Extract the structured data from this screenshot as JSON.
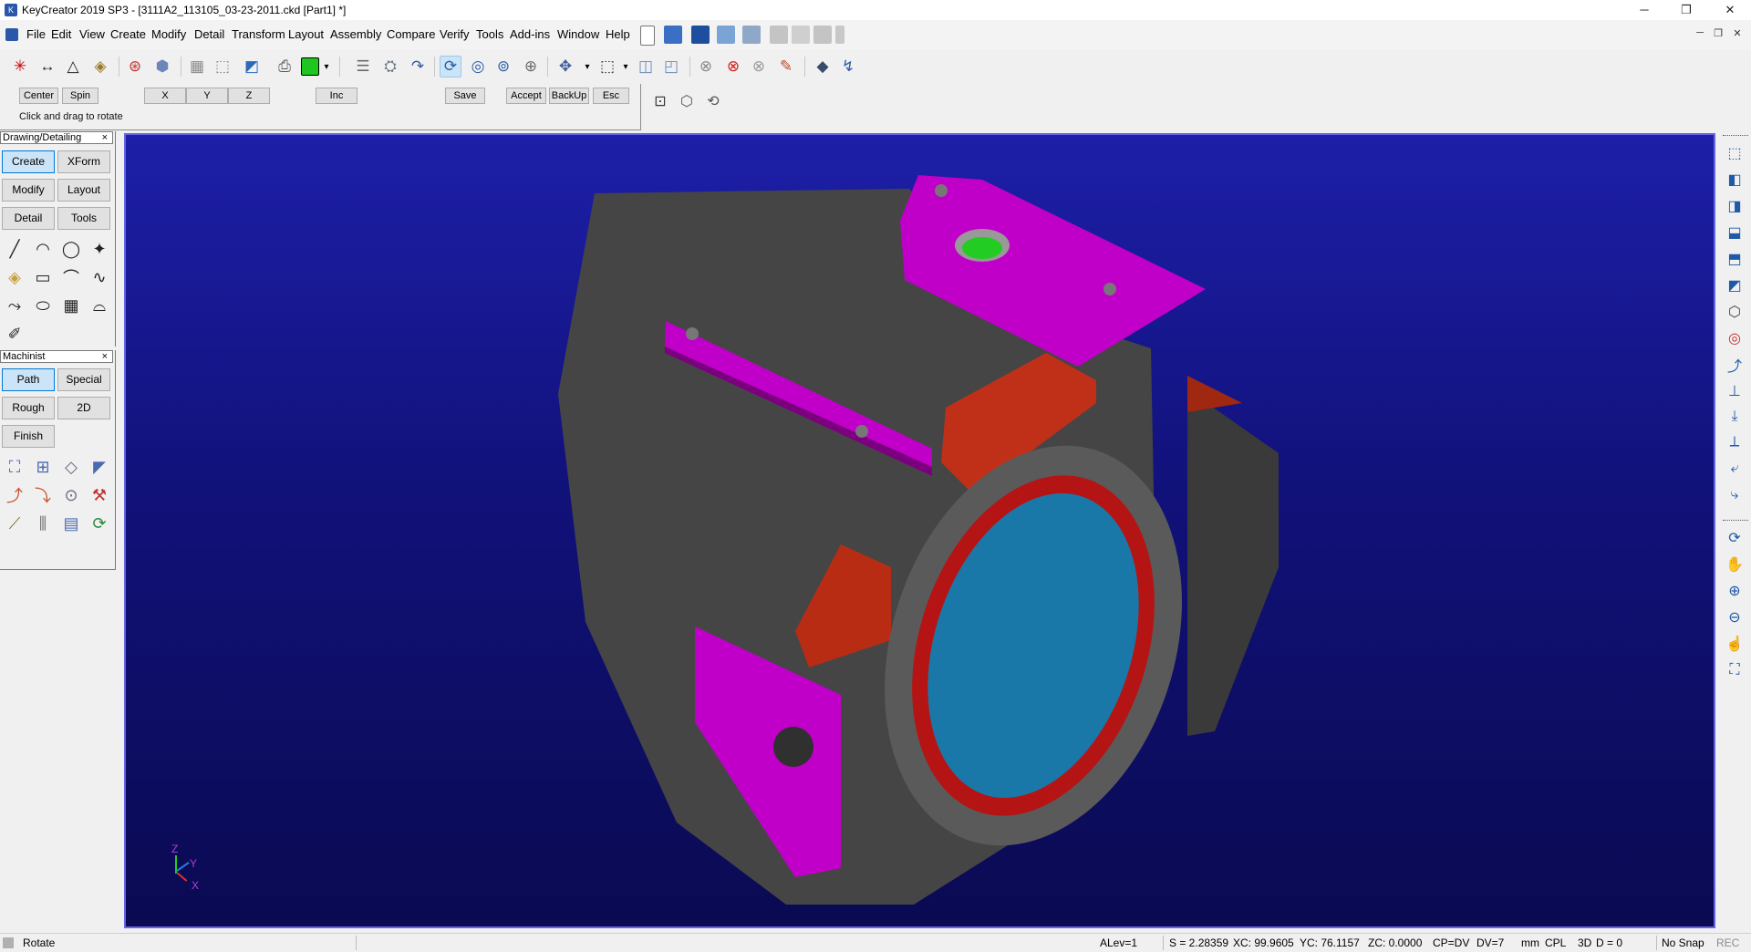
{
  "window": {
    "title": "KeyCreator 2019 SP3 - [3111A2_113105_03-23-2011.ckd [Part1] *]",
    "controls": {
      "minimize": "─",
      "restore": "❐",
      "close": "✕"
    }
  },
  "menu": {
    "items": [
      "File",
      "Edit",
      "View",
      "Create",
      "Modify",
      "Detail",
      "Transform",
      "Layout",
      "Assembly",
      "Compare",
      "Verify",
      "Tools",
      "Add-ins",
      "Window",
      "Help"
    ],
    "mdi": {
      "minimize": "─",
      "restore": "❐",
      "close": "✕"
    }
  },
  "prompt": {
    "buttons": {
      "center": "Center",
      "spin": "Spin",
      "x": "X",
      "y": "Y",
      "z": "Z",
      "inc": "Inc",
      "save": "Save",
      "accept": "Accept",
      "backup": "BackUp",
      "esc": "Esc"
    },
    "message": "Click and drag to rotate"
  },
  "palettes": {
    "drawing": {
      "title": "Drawing/Detailing",
      "close": "×",
      "buttons": [
        "Create",
        "XForm",
        "Modify",
        "Layout",
        "Detail",
        "Tools"
      ],
      "selected": "Create"
    },
    "machinist": {
      "title": "Machinist",
      "close": "×",
      "buttons": [
        "Path",
        "Special",
        "Rough",
        "2D",
        "Finish"
      ],
      "selected": "Path"
    }
  },
  "triad": {
    "z": "Z",
    "y": "Y",
    "x": "X"
  },
  "colors": {
    "viewport_top": "#1d1fa8",
    "viewport_bottom": "#0a0a52",
    "body": "#4a4a4a",
    "magenta": "#c000c8",
    "red": "#c03018",
    "bore": "#1a78a8",
    "hole": "#22cc22"
  },
  "status": {
    "mode": "Rotate",
    "alev": "ALev=1",
    "scale": "S = 2.28359",
    "xc": "XC: 99.9605",
    "yc": "YC: 76.1157",
    "zc": "ZC: 0.0000",
    "cp": "CP=DV",
    "dv": "DV=7",
    "units": "mm",
    "cpl": "CPL",
    "dim": "3D",
    "d": "D = 0",
    "snap": "No Snap",
    "rec": "REC"
  }
}
